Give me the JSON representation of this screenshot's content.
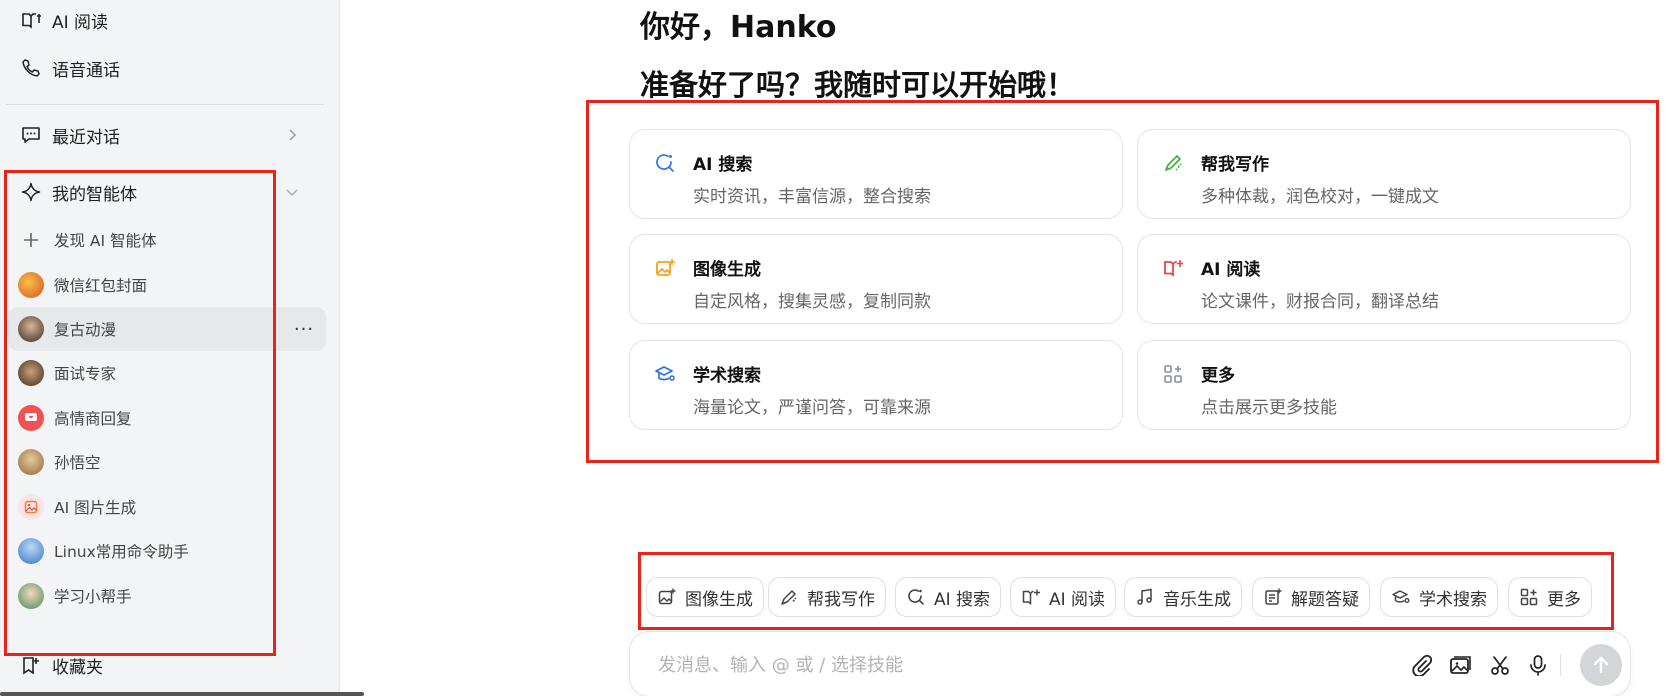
{
  "sidebar": {
    "ai_read": "AI 阅读",
    "voice_call": "语音通话",
    "recent": "最近对话",
    "my_agents": "我的智能体",
    "discover": "发现 AI 智能体",
    "agents": [
      {
        "label": "微信红包封面",
        "color": "#e0862a"
      },
      {
        "label": "复古动漫",
        "color": "#5a3a2e"
      },
      {
        "label": "面试专家",
        "color": "#7a5a3a"
      },
      {
        "label": "高情商回复",
        "color": "#f04b4b"
      },
      {
        "label": "孙悟空",
        "color": "#b89060"
      },
      {
        "label": "AI 图片生成",
        "color": "#f7c8c8"
      },
      {
        "label": "Linux常用命令助手",
        "color": "#4a90d9"
      },
      {
        "label": "学习小帮手",
        "color": "#7cc08a"
      }
    ],
    "favorites": "收藏夹",
    "more_menu": "···"
  },
  "main": {
    "greeting": "你好，Hanko",
    "subgreeting": "准备好了吗？我随时可以开始哦！",
    "cards": [
      {
        "icon": "search-icon",
        "title": "AI 搜索",
        "desc": "实时资讯，丰富信源，整合搜索",
        "color": "#2f7be8"
      },
      {
        "icon": "pen-icon",
        "title": "帮我写作",
        "desc": "多种体裁，润色校对，一键成文",
        "color": "#44b53a"
      },
      {
        "icon": "image-icon",
        "title": "图像生成",
        "desc": "自定风格，搜集灵感，复制同款",
        "color": "#f0a21b"
      },
      {
        "icon": "book-icon",
        "title": "AI 阅读",
        "desc": "论文课件，财报合同，翻译总结",
        "color": "#e84646"
      },
      {
        "icon": "academic-icon",
        "title": "学术搜索",
        "desc": "海量论文，严谨问答，可靠来源",
        "color": "#2f6fe0"
      },
      {
        "icon": "grid-icon",
        "title": "更多",
        "desc": "点击展示更多技能",
        "color": "#8a8f99"
      }
    ],
    "chips": [
      {
        "icon": "image-icon",
        "label": "图像生成"
      },
      {
        "icon": "pen-icon",
        "label": "帮我写作"
      },
      {
        "icon": "search-icon",
        "label": "AI 搜索"
      },
      {
        "icon": "book-icon",
        "label": "AI 阅读"
      },
      {
        "icon": "music-icon",
        "label": "音乐生成"
      },
      {
        "icon": "quiz-icon",
        "label": "解题答疑"
      },
      {
        "icon": "academic-icon",
        "label": "学术搜索"
      },
      {
        "icon": "grid-icon",
        "label": "更多"
      }
    ],
    "input_placeholder": "发消息、输入 @ 或 / 选择技能"
  },
  "colors": {
    "annotation_red": "#e8231a"
  }
}
